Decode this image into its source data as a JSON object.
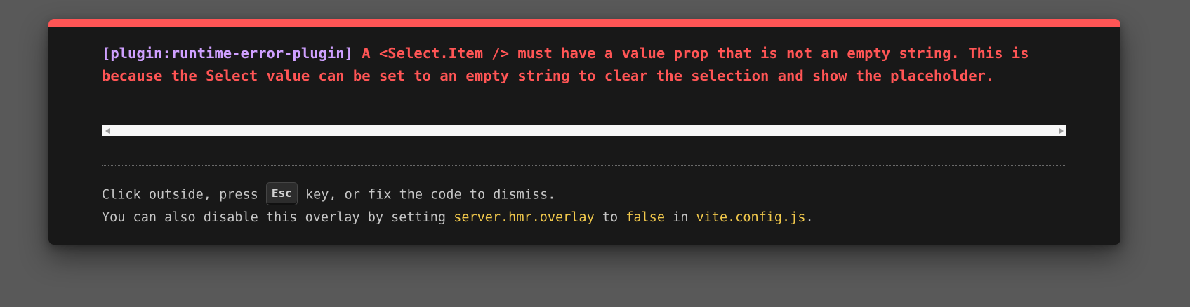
{
  "error": {
    "plugin": "[plugin:runtime-error-plugin]",
    "message": " A <Select.Item /> must have a value prop that is not an empty string. This is because the Select value can be set to an empty string to clear the selection and show the placeholder."
  },
  "tip": {
    "line1_before": "Click outside, press ",
    "key": "Esc",
    "line1_after": " key, or fix the code to dismiss.",
    "line2_before": "You can also disable this overlay by setting ",
    "setting": "server.hmr.overlay",
    "line2_mid1": " to ",
    "value": "false",
    "line2_mid2": " in ",
    "file": "vite.config.js",
    "line2_end": "."
  },
  "colors": {
    "accent_red": "#ff5555",
    "plugin_purple": "#cfa0ff",
    "code_yellow": "#f2c94c",
    "background": "#181818",
    "backdrop": "#595959"
  },
  "icons": {
    "scroll_left": "scroll-left-arrow-icon",
    "scroll_right": "scroll-right-arrow-icon"
  }
}
